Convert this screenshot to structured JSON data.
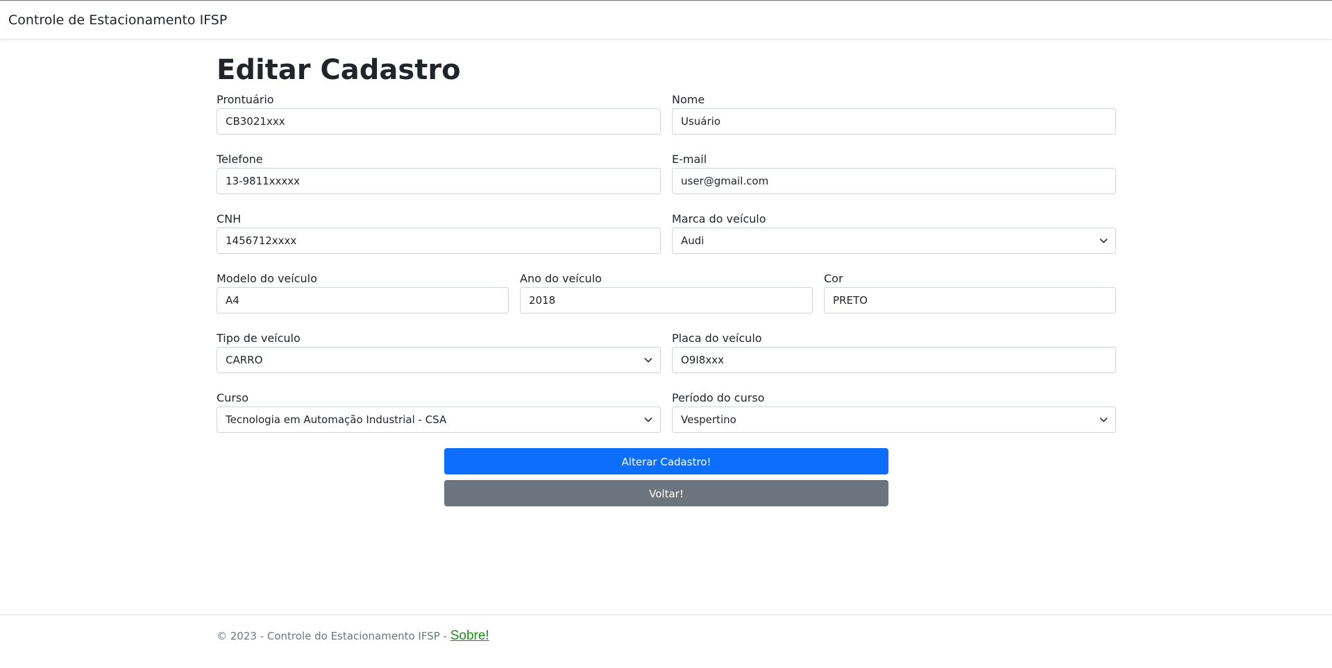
{
  "navbar": {
    "brand": "Controle de Estacionamento IFSP"
  },
  "page": {
    "title": "Editar Cadastro"
  },
  "form": {
    "prontuario": {
      "label": "Prontuário",
      "value": "CB3021xxx"
    },
    "nome": {
      "label": "Nome",
      "value": "Usuário"
    },
    "telefone": {
      "label": "Telefone",
      "value": "13-9811xxxxx"
    },
    "email": {
      "label": "E-mail",
      "value": "user@gmail.com"
    },
    "cnh": {
      "label": "CNH",
      "value": "1456712xxxx"
    },
    "marca": {
      "label": "Marca do veículo",
      "value": "Audi"
    },
    "modelo": {
      "label": "Modelo do veículo",
      "value": "A4"
    },
    "ano": {
      "label": "Ano do veículo",
      "value": "2018"
    },
    "cor": {
      "label": "Cor",
      "value": "PRETO"
    },
    "tipo": {
      "label": "Tipo de veículo",
      "value": "CARRO"
    },
    "placa": {
      "label": "Placa do veículo",
      "value": "O9I8xxx"
    },
    "curso": {
      "label": "Curso",
      "value": "Tecnologia em Automação Industrial - CSA"
    },
    "periodo": {
      "label": "Período do curso",
      "value": "Vespertino"
    }
  },
  "buttons": {
    "submit": "Alterar Cadastro!",
    "back": "Voltar!"
  },
  "footer": {
    "text": "© 2023 - Controle do Estacionamento IFSP - ",
    "link": "Sobre!"
  },
  "colors": {
    "primary": "#0d6efd",
    "secondary": "#6c757d",
    "footer_link": "#1e8a1e"
  },
  "icons": {
    "select_arrow": "chevron-down-icon"
  }
}
